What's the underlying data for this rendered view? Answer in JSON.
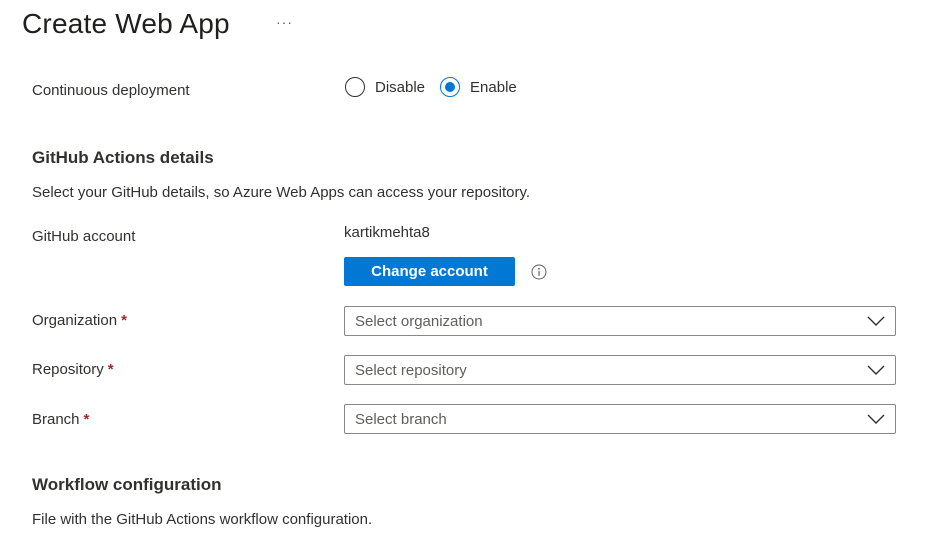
{
  "header": {
    "title": "Create Web App",
    "more_icon": "ellipsis-icon",
    "more_glyph": "···"
  },
  "deployment": {
    "label": "Continuous deployment",
    "options": [
      {
        "label": "Disable",
        "selected": false
      },
      {
        "label": "Enable",
        "selected": true
      }
    ]
  },
  "github": {
    "heading": "GitHub Actions details",
    "description": "Select your GitHub details, so Azure Web Apps can access your repository.",
    "account_label": "GitHub account",
    "account_name": "kartikmehta8",
    "change_account_label": "Change account",
    "info_icon": "info-icon",
    "required_marker": "*",
    "fields": {
      "organization": {
        "label": "Organization",
        "placeholder": "Select organization"
      },
      "repository": {
        "label": "Repository",
        "placeholder": "Select repository"
      },
      "branch": {
        "label": "Branch",
        "placeholder": "Select branch"
      }
    }
  },
  "workflow": {
    "heading": "Workflow configuration",
    "description": "File with the GitHub Actions workflow configuration."
  },
  "colors": {
    "accent": "#0078d4",
    "required": "#a4262c",
    "border": "#8a8886",
    "text": "#323130"
  }
}
